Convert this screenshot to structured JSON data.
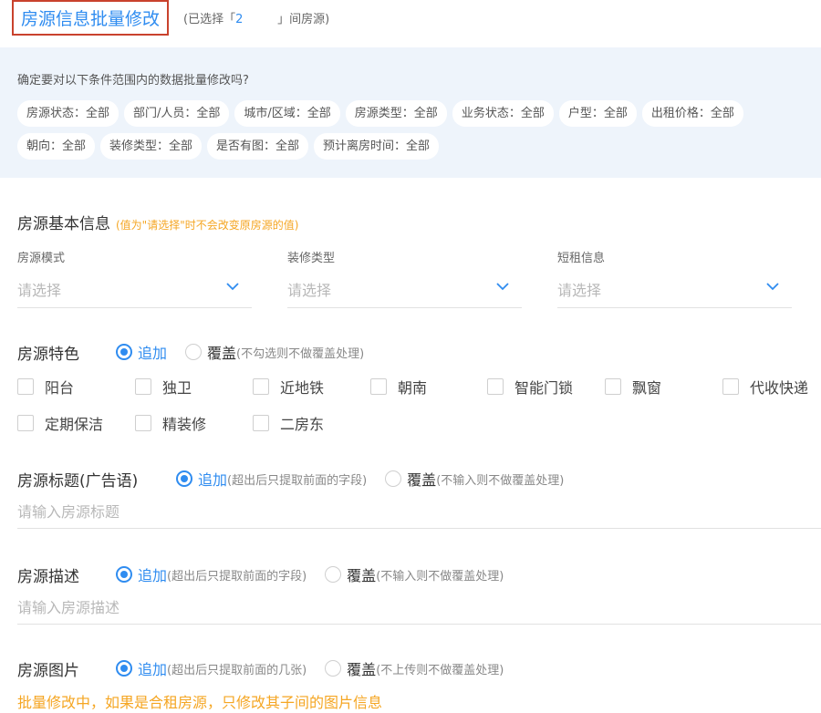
{
  "header": {
    "title": "房源信息批量修改",
    "sub_prefix": "(已选择「",
    "sub_count": "2",
    "sub_suffix": "」间房源)"
  },
  "conditions": {
    "question": "确定要对以下条件范围内的数据批量修改吗?",
    "row1": [
      "房源状态：全部",
      "部门/人员：全部",
      "城市/区域：全部",
      "房源类型：全部",
      "业务状态：全部",
      "户型：全部",
      "出租价格：全部"
    ],
    "row2": [
      "朝向：全部",
      "装修类型：全部",
      "是否有图：全部",
      "预计离房时间：全部"
    ]
  },
  "basic": {
    "title": "房源基本信息",
    "note": "(值为\"请选择\"时不会改变原房源的值)",
    "fields": [
      {
        "label": "房源模式",
        "placeholder": "请选择"
      },
      {
        "label": "装修类型",
        "placeholder": "请选择"
      },
      {
        "label": "短租信息",
        "placeholder": "请选择"
      }
    ]
  },
  "features": {
    "title": "房源特色",
    "append": "追加",
    "cover": "覆盖",
    "cover_hint": "(不勾选则不做覆盖处理)",
    "options": [
      "阳台",
      "独卫",
      "近地铁",
      "朝南",
      "智能门锁",
      "飘窗",
      "代收快递",
      "定期保洁",
      "精装修",
      "二房东"
    ]
  },
  "ad_title": {
    "title": "房源标题(广告语)",
    "append": "追加",
    "append_hint": "(超出后只提取前面的字段)",
    "cover": "覆盖",
    "cover_hint": "(不输入则不做覆盖处理)",
    "placeholder": "请输入房源标题"
  },
  "desc": {
    "title": "房源描述",
    "append": "追加",
    "append_hint": "(超出后只提取前面的字段)",
    "cover": "覆盖",
    "cover_hint": "(不输入则不做覆盖处理)",
    "placeholder": "请输入房源描述"
  },
  "images": {
    "title": "房源图片",
    "append": "追加",
    "append_hint": "(超出后只提取前面的几张)",
    "cover": "覆盖",
    "cover_hint": "(不上传则不做覆盖处理)",
    "note": "批量修改中，如果是合租房源，只修改其子间的图片信息"
  },
  "colors": {
    "accent": "#2f8cf0",
    "warning": "#f5a623",
    "highlight_border": "#c9422d"
  },
  "icons": {
    "select_arrow": "chevron-down-icon"
  }
}
